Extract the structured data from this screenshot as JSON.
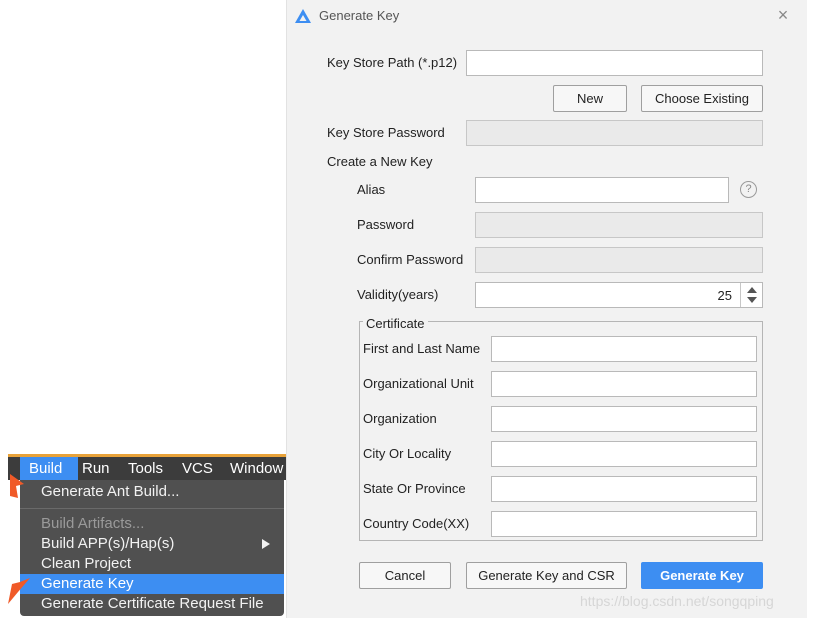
{
  "dialog": {
    "title": "Generate Key",
    "keystore_path": {
      "label": "Key Store Path (*.p12)",
      "value": ""
    },
    "buttons": {
      "new": "New",
      "choose_existing": "Choose Existing"
    },
    "keystore_password": {
      "label": "Key Store Password",
      "value": ""
    },
    "section_new_key": "Create a New Key",
    "alias": {
      "label": "Alias",
      "value": ""
    },
    "password": {
      "label": "Password",
      "value": ""
    },
    "confirm_password": {
      "label": "Confirm Password",
      "value": ""
    },
    "validity": {
      "label": "Validity(years)",
      "value": "25"
    },
    "certificate": {
      "legend": "Certificate",
      "fields": [
        {
          "label": "First and Last Name",
          "value": ""
        },
        {
          "label": "Organizational Unit",
          "value": ""
        },
        {
          "label": "Organization",
          "value": ""
        },
        {
          "label": "City Or Locality",
          "value": ""
        },
        {
          "label": "State Or Province",
          "value": ""
        },
        {
          "label": "Country Code(XX)",
          "value": ""
        }
      ]
    },
    "footer": {
      "cancel": "Cancel",
      "generate_key_csr": "Generate Key and CSR",
      "generate_key": "Generate Key"
    },
    "icons": {
      "logo": "app-logo-icon",
      "close": "close-icon",
      "help": "help-icon",
      "help_glyph": "?"
    }
  },
  "menu": {
    "menubar": [
      "Build",
      "Run",
      "Tools",
      "VCS",
      "Window"
    ],
    "items": [
      {
        "label": "Generate Ant Build...",
        "state": "normal"
      },
      {
        "label": "Build Artifacts...",
        "state": "disabled"
      },
      {
        "label": "Build APP(s)/Hap(s)",
        "state": "normal",
        "has_submenu": true
      },
      {
        "label": "Clean Project",
        "state": "normal"
      },
      {
        "label": "Generate Key",
        "state": "highlighted"
      },
      {
        "label": "Generate Certificate Request File",
        "state": "normal"
      }
    ]
  },
  "watermark": "https://blog.csdn.net/songqping",
  "colors": {
    "accent": "#3d8ef2",
    "dialog_bg": "#f2f2f2",
    "menu_bg": "#505050",
    "menubar_bg": "#3c3c3c",
    "menubar_border": "#e8a239",
    "pointer_arrow": "#f05a28"
  }
}
